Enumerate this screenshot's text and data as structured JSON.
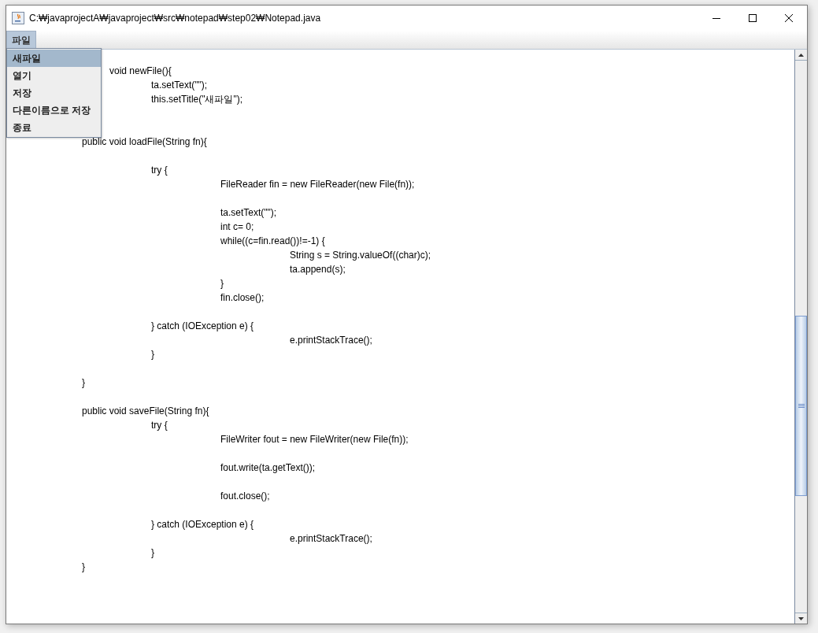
{
  "window": {
    "title": "C:₩javaprojectA₩javaproject₩src₩notepad₩step02₩Notepad.java"
  },
  "menu_bar": [
    {
      "label": "파일",
      "selected": true
    }
  ],
  "menu": [
    {
      "label": "새파일",
      "selected": true
    },
    {
      "label": "열기",
      "selected": false
    },
    {
      "label": "저장",
      "selected": false
    },
    {
      "label": "다른이름으로 저장",
      "selected": false
    },
    {
      "label": "종료",
      "selected": false
    }
  ],
  "editor_blocks": [
    {
      "kind": "covered",
      "text": "\tvoid newFile(){"
    },
    {
      "kind": "code",
      "text": "\t\tta.setText(\"\");\n\t\tthis.setTitle(\"새파일\");"
    },
    {
      "kind": "code",
      "text": "\tpublic void loadFile(String fn){\n\n\t\ttry {\n\t\t\tFileReader fin = new FileReader(new File(fn));\n\n\t\t\tta.setText(\"\");\n\t\t\tint c= 0;\n\t\t\twhile((c=fin.read())!=-1) {\n\t\t\t\tString s = String.valueOf((char)c);\n\t\t\t\tta.append(s);\n\t\t\t}\n\t\t\tfin.close();\n\n\t\t} catch (IOException e) {\n\t\t\t\te.printStackTrace();\n\t\t}\n\n\t}\n\n\tpublic void saveFile(String fn){\n\t\ttry {\n\t\t\tFileWriter fout = new FileWriter(new File(fn));\n\n\t\t\tfout.write(ta.getText());\n\n\t\t\tfout.close();\n\n\t\t} catch (IOException e) {\n\t\t\t\te.printStackTrace();\n\t\t}\n\t}"
    }
  ]
}
